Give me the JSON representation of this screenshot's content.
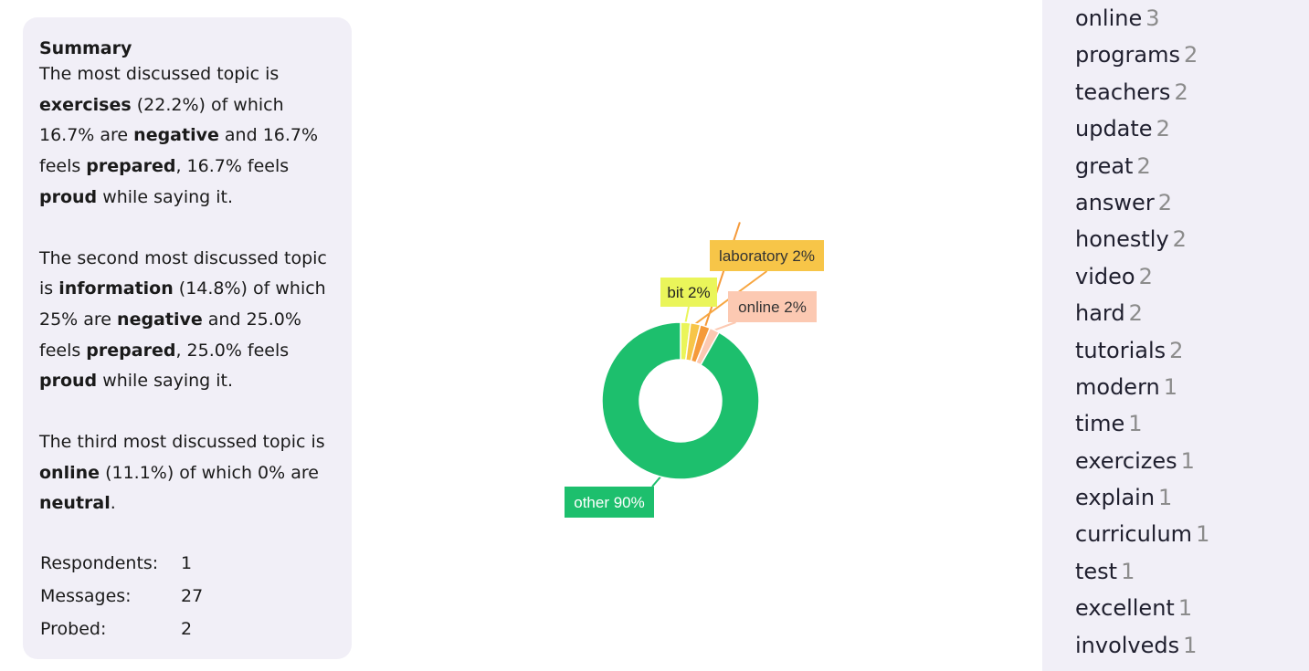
{
  "summary": {
    "title": "Summary",
    "p1": [
      {
        "t": "The most discussed topic is "
      },
      {
        "t": "exercises",
        "b": true
      },
      {
        "t": " (22.2%) of which 16.7% are "
      },
      {
        "t": "negative",
        "b": true
      },
      {
        "t": " and 16.7% feels "
      },
      {
        "t": "prepared",
        "b": true
      },
      {
        "t": ", 16.7% feels "
      },
      {
        "t": "proud",
        "b": true
      },
      {
        "t": " while saying it."
      }
    ],
    "p2": [
      {
        "t": "The second most discussed topic is "
      },
      {
        "t": "information",
        "b": true
      },
      {
        "t": " (14.8%) of which 25% are "
      },
      {
        "t": "negative",
        "b": true
      },
      {
        "t": " and 25.0% feels "
      },
      {
        "t": "prepared",
        "b": true
      },
      {
        "t": ", 25.0% feels "
      },
      {
        "t": "proud",
        "b": true
      },
      {
        "t": " while saying it."
      }
    ],
    "p3": [
      {
        "t": "The third most discussed topic is "
      },
      {
        "t": "online",
        "b": true
      },
      {
        "t": " (11.1%) of which 0% are "
      },
      {
        "t": "neutral",
        "b": true
      },
      {
        "t": "."
      }
    ],
    "stats": [
      {
        "label": "Respondents:",
        "value": "1"
      },
      {
        "label": "Messages:",
        "value": "27"
      },
      {
        "label": "Probed:",
        "value": "2"
      }
    ]
  },
  "chart_data": {
    "type": "pie",
    "donut": true,
    "title": "",
    "slices": [
      {
        "label": "bit",
        "value": 2,
        "display": "bit 2%",
        "color": "#eaf55a"
      },
      {
        "label": "laboratory",
        "value": 2,
        "display": "laboratory 2%",
        "color": "#f7c548"
      },
      {
        "label": "",
        "value": 2,
        "display": "",
        "color": "#f59a3a"
      },
      {
        "label": "online",
        "value": 2,
        "display": "online 2%",
        "color": "#fcc9b2"
      },
      {
        "label": "other",
        "value": 90,
        "display": "other 90%",
        "color": "#1dbf6d"
      }
    ]
  },
  "words": [
    {
      "word": "online",
      "count": "3"
    },
    {
      "word": "programs",
      "count": "2"
    },
    {
      "word": "teachers",
      "count": "2"
    },
    {
      "word": "update",
      "count": "2"
    },
    {
      "word": "great",
      "count": "2"
    },
    {
      "word": "answer",
      "count": "2"
    },
    {
      "word": "honestly",
      "count": "2"
    },
    {
      "word": "video",
      "count": "2"
    },
    {
      "word": "hard",
      "count": "2"
    },
    {
      "word": "tutorials",
      "count": "2"
    },
    {
      "word": "modern",
      "count": "1"
    },
    {
      "word": "time",
      "count": "1"
    },
    {
      "word": "exercizes",
      "count": "1"
    },
    {
      "word": "explain",
      "count": "1"
    },
    {
      "word": "curriculum",
      "count": "1"
    },
    {
      "word": "test",
      "count": "1"
    },
    {
      "word": "excellent",
      "count": "1"
    },
    {
      "word": "involveds",
      "count": "1"
    }
  ]
}
